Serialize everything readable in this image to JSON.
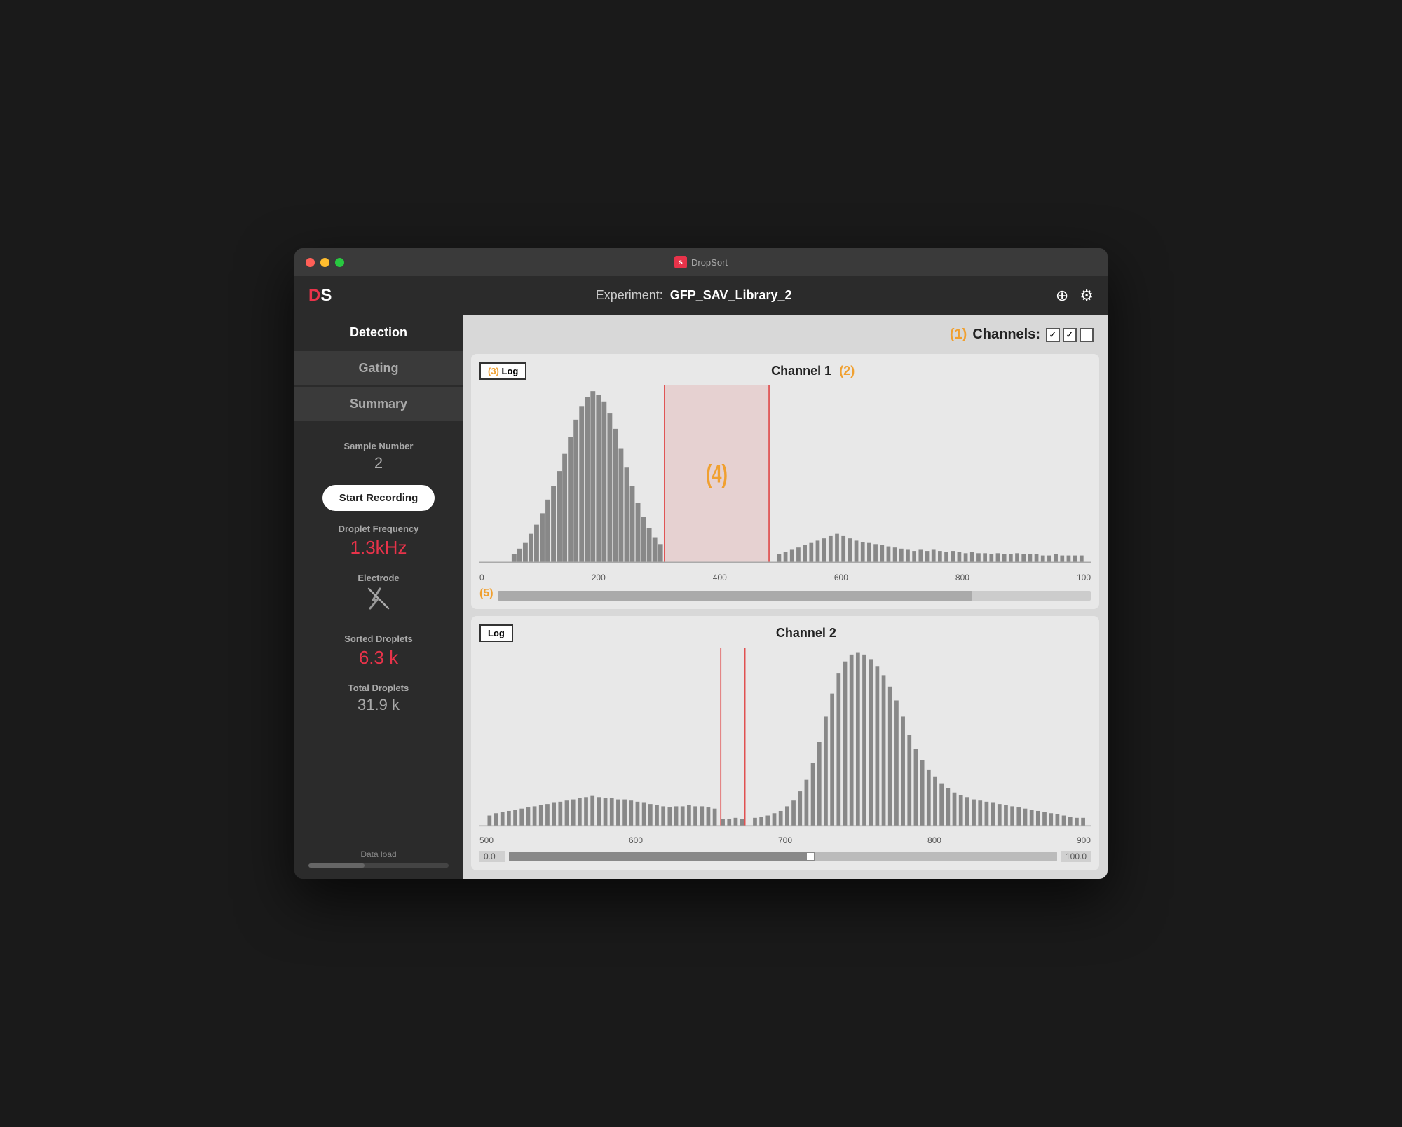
{
  "window": {
    "title": "DropSort"
  },
  "header": {
    "logo": "DS",
    "experiment_label": "Experiment:",
    "experiment_name": "GFP_SAV_Library_2",
    "add_icon": "⊕",
    "settings_icon": "⚙"
  },
  "sidebar": {
    "nav": [
      {
        "id": "detection",
        "label": "Detection",
        "active": true
      },
      {
        "id": "gating",
        "label": "Gating",
        "active": false
      },
      {
        "id": "summary",
        "label": "Summary",
        "active": false
      }
    ],
    "sample_number_label": "Sample Number",
    "sample_number_value": "2",
    "start_recording_label": "Start Recording",
    "droplet_frequency_label": "Droplet Frequency",
    "droplet_frequency_value": "1.3kHz",
    "electrode_label": "Electrode",
    "sorted_droplets_label": "Sorted Droplets",
    "sorted_droplets_value": "6.3 k",
    "total_droplets_label": "Total Droplets",
    "total_droplets_value": "31.9 k",
    "data_load_label": "Data load",
    "data_load_percent": 40
  },
  "content": {
    "channels_label": "(1)",
    "channels_text": "Channels:",
    "channel1": {
      "title": "Channel 1",
      "number_label": "(2)",
      "log_label": "Log",
      "log_number_label": "(3)",
      "gate_label": "(4)",
      "scrollbar_label": "(5)",
      "axis_ticks": [
        "0",
        "200",
        "400",
        "600",
        "800",
        "100"
      ]
    },
    "channel2": {
      "title": "Channel 2",
      "log_label": "Log",
      "axis_ticks": [
        "500",
        "600",
        "700",
        "800",
        "900"
      ],
      "slider_left": "0.0",
      "slider_right": "100.0"
    }
  }
}
